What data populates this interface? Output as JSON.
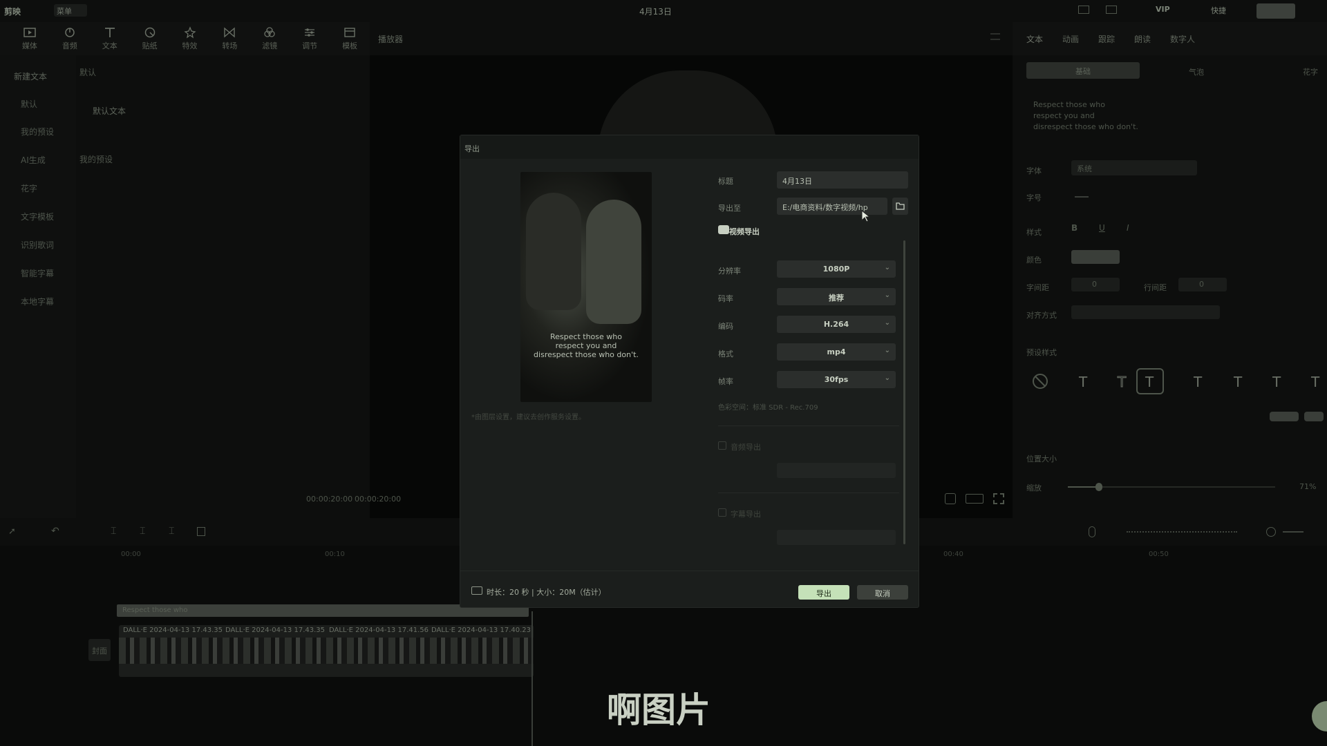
{
  "app": {
    "logo": "剪映",
    "menu": "菜单",
    "title": "4月13日",
    "vip": "VIP",
    "shortcut": "快捷"
  },
  "toolbar": [
    {
      "label": "媒体",
      "icon": "media-icon"
    },
    {
      "label": "音频",
      "icon": "audio-icon"
    },
    {
      "label": "文本",
      "icon": "text-icon"
    },
    {
      "label": "贴纸",
      "icon": "sticker-icon"
    },
    {
      "label": "特效",
      "icon": "effects-icon"
    },
    {
      "label": "转场",
      "icon": "transition-icon"
    },
    {
      "label": "滤镜",
      "icon": "filter-icon"
    },
    {
      "label": "调节",
      "icon": "adjust-icon"
    },
    {
      "label": "模板",
      "icon": "template-icon"
    }
  ],
  "leftnav": [
    "新建文本",
    "默认",
    "我的预设",
    "AI生成",
    "花字",
    "文字模板",
    "识别歌词",
    "智能字幕",
    "本地字幕"
  ],
  "textpanel": {
    "section1": "默认",
    "item": "默认文本",
    "section2": "我的预设"
  },
  "player": {
    "title": "播放器",
    "time_current": "00:00:20:00",
    "time_total": "00:00:20:00"
  },
  "rightpanel": {
    "tabs": [
      "文本",
      "动画",
      "跟踪",
      "朗读",
      "数字人"
    ],
    "subtabs": [
      "基础",
      "气泡",
      "花字"
    ],
    "text_content": [
      "Respect those who",
      "respect you and",
      "disrespect those who don't."
    ],
    "font_label": "字体",
    "font_value": "系统",
    "size_label": "字号",
    "style_label": "样式",
    "color_label": "颜色",
    "spacing_label": "字间距",
    "spacing_value": "0",
    "line_label": "行间距",
    "line_value": "0",
    "align_label": "对齐方式",
    "preset_label": "预设样式",
    "position_label": "位置大小",
    "scale_label": "缩放",
    "scale_value": "71%"
  },
  "timeline": {
    "text_clip": "Respect those who",
    "cover_label": "封面",
    "clips": [
      "DALL·E 2024-04-13 17.43.35",
      "DALL·E 2024-04-13 17.43.35",
      "DALL·E 2024-04-13 17.41.56",
      "DALL·E 2024-04-13 17.40.23"
    ],
    "ruler": [
      "00:00",
      "00:10",
      "00:40",
      "00:50"
    ]
  },
  "dialog": {
    "title": "导出",
    "preview_caption": [
      "Respect those who",
      "respect you and",
      "disrespect those who don't."
    ],
    "note": "*由图层设置，建议去创作服务设置。",
    "name_label": "标题",
    "name_value": "4月13日",
    "path_label": "导出至",
    "path_value": "E:/电商资料/数字视频/hp",
    "video_section": "视频导出",
    "resolution_label": "分辨率",
    "resolution_value": "1080P",
    "bitrate_label": "码率",
    "bitrate_value": "推荐",
    "codec_label": "编码",
    "codec_value": "H.264",
    "format_label": "格式",
    "format_value": "mp4",
    "fps_label": "帧率",
    "fps_value": "30fps",
    "color_space": "色彩空间：标准 SDR - Rec.709",
    "audio_section": "音频导出",
    "subtitle_section": "字幕导出",
    "footer_info": "时长：20 秒 | 大小：20M（估计）",
    "export_button": "导出",
    "cancel_button": "取消"
  },
  "subtitle_overlay": "啊图片"
}
